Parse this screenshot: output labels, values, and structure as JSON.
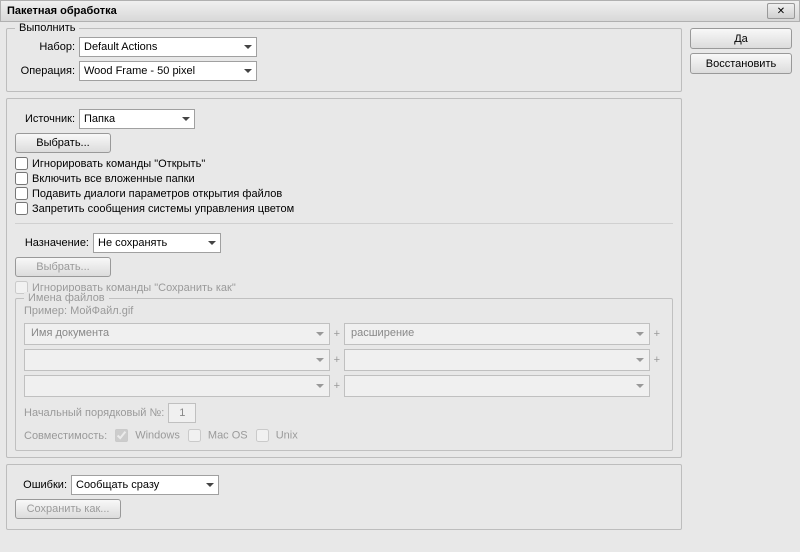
{
  "window": {
    "title": "Пакетная обработка"
  },
  "buttons": {
    "ok": "Да",
    "reset": "Восстановить",
    "close_x": "✕"
  },
  "play": {
    "legend": "Выполнить",
    "set_label": "Набор:",
    "set_value": "Default Actions",
    "op_label": "Операция:",
    "op_value": "Wood Frame - 50 pixel"
  },
  "source": {
    "label": "Источник:",
    "value": "Папка",
    "choose": "Выбрать...",
    "c1": "Игнорировать команды \"Открыть\"",
    "c2": "Включить все вложенные папки",
    "c3": "Подавить диалоги параметров открытия файлов",
    "c4": "Запретить сообщения системы управления цветом"
  },
  "dest": {
    "label": "Назначение:",
    "value": "Не сохранять",
    "choose": "Выбрать...",
    "override": "Игнорировать команды \"Сохранить как\""
  },
  "fname": {
    "legend": "Имена файлов",
    "example_label": "Пример:",
    "example_value": "МойФайл.gif",
    "field1": "Имя документа",
    "field2": "расширение",
    "start_label": "Начальный порядковый №:",
    "start_value": "1",
    "compat_label": "Совместимость:",
    "win": "Windows",
    "mac": "Mac OS",
    "unix": "Unix"
  },
  "errors": {
    "label": "Ошибки:",
    "value": "Сообщать сразу",
    "save_as": "Сохранить как..."
  }
}
